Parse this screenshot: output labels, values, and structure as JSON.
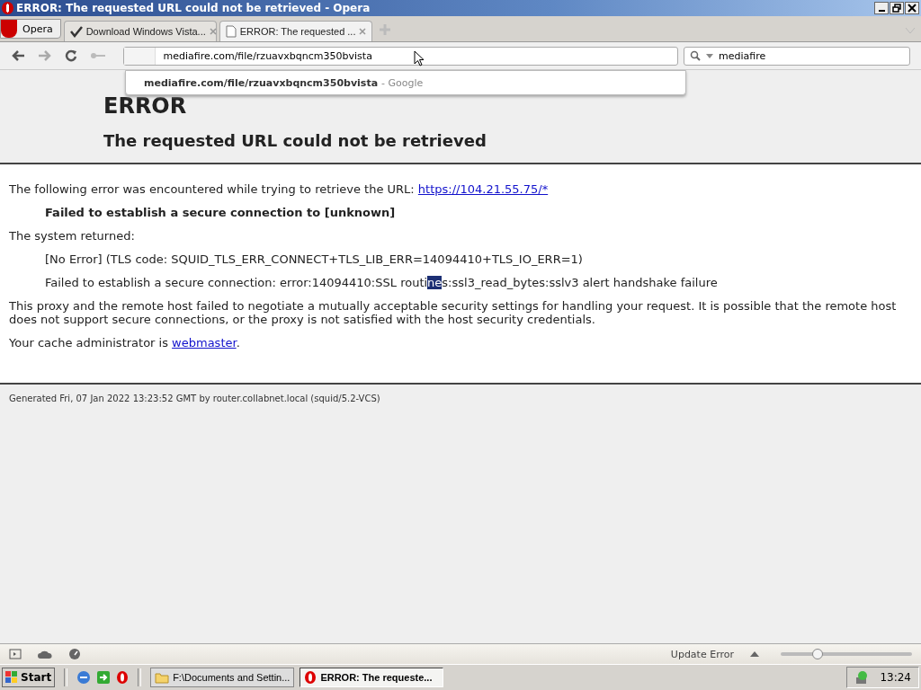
{
  "window": {
    "title": "ERROR: The requested URL could not be retrieved - Opera"
  },
  "opera_button": "Opera",
  "tabs": [
    {
      "label": "Download Windows Vista...",
      "selected": false
    },
    {
      "label": "ERROR: The requested ...",
      "selected": true
    }
  ],
  "address_bar": {
    "value": "mediafire.com/file/rzuavxbqncm350bvista"
  },
  "address_suggestion": {
    "text": "mediafire.com/file/rzuavxbqncm350bvista",
    "source": "- Google"
  },
  "search_field": {
    "value": "mediafire"
  },
  "page": {
    "heading": "ERROR",
    "subheading": "The requested URL could not be retrieved",
    "intro": "The following error was encountered while trying to retrieve the URL: ",
    "intro_link": "https://104.21.55.75/*",
    "error_message": "Failed to establish a secure connection to [unknown]",
    "system_returned": "The system returned:",
    "tls_code": "[No Error] (TLS code: SQUID_TLS_ERR_CONNECT+TLS_LIB_ERR=14094410+TLS_IO_ERR=1)",
    "detail": {
      "before": "Failed to establish a secure connection: error:14094410:SSL routi",
      "selected": "ne",
      "after": "s:ssl3_read_bytes:sslv3 alert handshake failure"
    },
    "explanation": "This proxy and the remote host failed to negotiate a mutually acceptable security settings for handling your request. It is possible that the remote host does not support secure connections, or the proxy is not satisfied with the host security credentials.",
    "admin_text": "Your cache administrator is ",
    "admin_link": "webmaster",
    "admin_end": ".",
    "footer": "Generated Fri, 07 Jan 2022 13:23:52 GMT by router.collabnet.local (squid/5.2-VCS)"
  },
  "status_bar": {
    "update": "Update Error",
    "zoom": {
      "level": 0.28
    }
  },
  "taskbar": {
    "start": "Start",
    "tasks": [
      {
        "label": "F:\\Documents and Settin...",
        "selected": false
      },
      {
        "label": "ERROR: The requeste...",
        "selected": true
      }
    ],
    "clock": "13:24"
  }
}
